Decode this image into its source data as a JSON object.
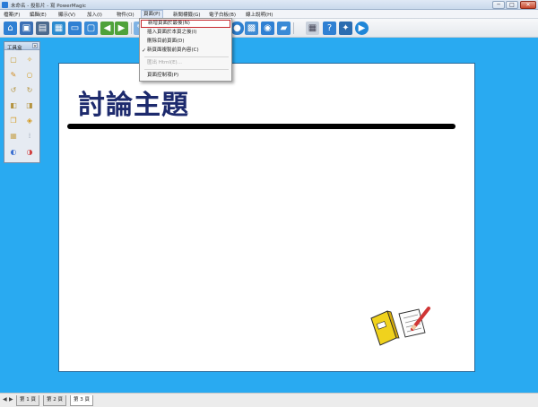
{
  "window": {
    "title": "未命名 - 投影片 - 寫 PowerMagic",
    "min_label": "─",
    "max_label": "□",
    "close_label": "✕"
  },
  "menubar": {
    "items": [
      "檔案(F)",
      "編輯(E)",
      "顯示(V)",
      "加入(I)",
      "物件(O)",
      "頁面(P)",
      "新聞標籤(G)",
      "電子白板(B)",
      "線上說明(H)"
    ]
  },
  "toolbar": {
    "buttons": [
      "home-icon",
      "save-icon",
      "print-icon",
      "image-icon",
      "slideshow-icon",
      "screen-icon",
      "back-icon",
      "forward-icon",
      "pen-icon",
      "user-icon",
      "photo-icon",
      "webcam-icon",
      "folder-icon",
      "calendar-icon",
      "help-icon",
      "tools-icon",
      "play-icon"
    ]
  },
  "page_menu": {
    "items": [
      {
        "label": "新增頁面於最後(N)",
        "state": "highlight"
      },
      {
        "label": "插入頁面於本頁之後(I)",
        "state": "normal"
      },
      {
        "label": "刪除目前頁面(D)",
        "state": "normal"
      },
      {
        "label": "新頁面複製前頁內容(C)",
        "state": "checked"
      },
      {
        "label": "匯出 Html(E)...",
        "state": "disabled"
      },
      {
        "label": "頁面控制項(P)",
        "state": "normal"
      }
    ]
  },
  "toolbox": {
    "title": "工具盒",
    "close_label": "×",
    "tools": [
      "page-icon",
      "wand-icon",
      "pencil-icon",
      "circle-icon",
      "rotate-left-icon",
      "rotate-right-icon",
      "flip-left-icon",
      "flip-right-icon",
      "copy-icon",
      "group-icon",
      "align-icon",
      "layers-icon",
      "toggle-a-icon",
      "toggle-b-icon"
    ]
  },
  "slide": {
    "title": "討論主題"
  },
  "status": {
    "tabs": [
      "第 1 頁",
      "第 2 頁",
      "第 3 頁"
    ],
    "current_tab": 2,
    "prev_arrow": "◀",
    "next_arrow": "▶"
  },
  "colors": {
    "canvas_background": "#29aaf1",
    "slide_title": "#1d2a6d",
    "menu_highlight_border": "#c6282e"
  }
}
